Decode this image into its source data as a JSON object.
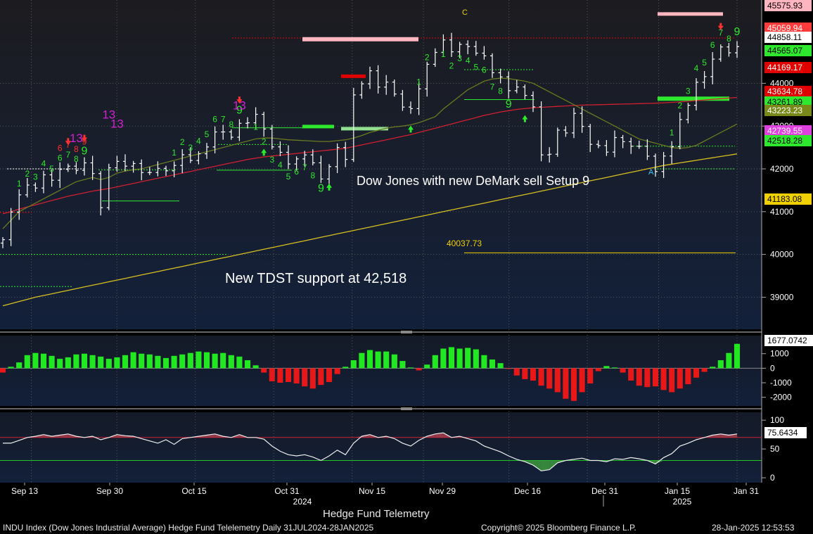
{
  "chart_data": {
    "type": "candlestick",
    "chart_title": "Hedge Fund Telemetry",
    "instrument_label": "INDU Index (Dow Jones Industrial Average) Hedge Fund Telelemetry  Daily 31JUL2024-28JAN2025",
    "copyright": "Copyright© 2025 Bloomberg Finance L.P.",
    "timestamp": "28-Jan-2025 12:53:53",
    "annotations": {
      "setup_note": "Dow Jones with new DeMark sell Setup 9",
      "tdst_note": "New TDST support at 42,518",
      "level_label": "40037.73",
      "c_marker": "C",
      "a_marker": "A"
    },
    "x_axis": {
      "tick_labels": [
        "Sep 13",
        "Sep 30",
        "Oct 15",
        "Oct 31",
        "Nov 15",
        "Nov 29",
        "Dec 16",
        "Dec 31",
        "Jan 15",
        "Jan 31"
      ],
      "year_labels": [
        "2024",
        "2025"
      ]
    },
    "price_panel": {
      "ylim": [
        38300,
        45750
      ],
      "y_ticks": [
        39000,
        40000,
        41000,
        42000,
        43000,
        44000
      ],
      "tag_values": [
        "45575.93",
        "45059.94",
        "44858.11",
        "44565.07",
        "44169.17",
        "43634.78",
        "43261.89",
        "43223.23",
        "42739.55",
        "42518.28",
        "41183.08"
      ],
      "tag_colors": [
        "#ffb6c1",
        "#ff3b3b",
        "#ffffff",
        "#2ee82e",
        "#e00000",
        "#e00000",
        "#2ee82e",
        "#7a8a1a",
        "#e040e0",
        "#2ee82e",
        "#f0d000"
      ],
      "closes": [
        40345,
        40990,
        41393,
        41622,
        41551,
        41861,
        41734,
        41988,
        42063,
        41965,
        42140,
        41890,
        41092,
        42025,
        42175,
        42063,
        42125,
        41914,
        41915,
        42012,
        41954,
        42080,
        42330,
        42196,
        42353,
        42512,
        42863,
        42864,
        42740,
        43065,
        43077,
        43275,
        42932,
        42514,
        42387,
        42114,
        42233,
        42326,
        42141,
        41763,
        42052,
        42500,
        42221,
        43729,
        43988,
        44293,
        43911,
        44029,
        43750,
        43445,
        43408,
        43870,
        44444,
        44722,
        45014,
        44736,
        44910,
        44860,
        44705,
        44642,
        44247,
        44149,
        43827,
        43914,
        43717,
        43449,
        42327,
        42342,
        42906,
        42840,
        43297,
        42992,
        42573,
        42544,
        42392,
        42732,
        42635,
        42529,
        42528,
        42297,
        41938,
        42300,
        42518,
        43153,
        43487,
        44025,
        44156,
        44565,
        44850,
        44713,
        44858
      ],
      "sma_olive": [
        40600,
        40800,
        41000,
        41100,
        41200,
        41300,
        41400,
        41500,
        41600,
        41700,
        41750,
        41800,
        41750,
        41800,
        41900,
        41950,
        41980,
        42000,
        42050,
        42100,
        42150,
        42200,
        42250,
        42300,
        42350,
        42400,
        42450,
        42500,
        42550,
        42600,
        42650,
        42700,
        42720,
        42720,
        42700,
        42680,
        42670,
        42660,
        42650,
        42640,
        42640,
        42660,
        42680,
        42720,
        42780,
        42850,
        42900,
        42950,
        42980,
        43000,
        43030,
        43080,
        43150,
        43220,
        43400,
        43550,
        43700,
        43850,
        43950,
        44050,
        44100,
        44120,
        44110,
        44080,
        44050,
        44000,
        43900,
        43800,
        43700,
        43600,
        43500,
        43400,
        43300,
        43200,
        43100,
        43000,
        42900,
        42800,
        42700,
        42650,
        42600,
        42550,
        42500,
        42480,
        42500,
        42550,
        42650,
        42750,
        42850,
        42950,
        43050
      ],
      "sma_red": [
        40950,
        41000,
        41060,
        41110,
        41160,
        41210,
        41260,
        41310,
        41360,
        41400,
        41440,
        41480,
        41510,
        41540,
        41580,
        41620,
        41660,
        41700,
        41740,
        41780,
        41820,
        41860,
        41900,
        41940,
        41980,
        42020,
        42060,
        42100,
        42140,
        42180,
        42220,
        42250,
        42280,
        42300,
        42320,
        42340,
        42360,
        42380,
        42400,
        42420,
        42440,
        42460,
        42480,
        42520,
        42560,
        42600,
        42640,
        42680,
        42720,
        42760,
        42800,
        42850,
        42900,
        42950,
        43000,
        43050,
        43100,
        43150,
        43200,
        43250,
        43290,
        43330,
        43360,
        43390,
        43410,
        43430,
        43440,
        43450,
        43460,
        43470,
        43480,
        43490,
        43495,
        43500,
        43505,
        43510,
        43515,
        43520,
        43525,
        43530,
        43535,
        43545,
        43555,
        43565,
        43580,
        43595,
        43610,
        43625,
        43640,
        43655,
        43670
      ],
      "sma_yellow": [
        38800,
        38850,
        38900,
        38950,
        39000,
        39040,
        39080,
        39120,
        39160,
        39200,
        39240,
        39280,
        39320,
        39360,
        39400,
        39440,
        39480,
        39520,
        39560,
        39600,
        39640,
        39680,
        39720,
        39760,
        39800,
        39840,
        39880,
        39920,
        39960,
        40000,
        40040,
        40080,
        40120,
        40160,
        40200,
        40240,
        40280,
        40320,
        40360,
        40400,
        40440,
        40480,
        40520,
        40560,
        40600,
        40640,
        40680,
        40720,
        40760,
        40800,
        40840,
        40880,
        40920,
        40960,
        41000,
        41040,
        41080,
        41120,
        41160,
        41200,
        41240,
        41280,
        41320,
        41360,
        41400,
        41440,
        41480,
        41520,
        41560,
        41600,
        41640,
        41680,
        41720,
        41760,
        41800,
        41840,
        41880,
        41920,
        41960,
        42000,
        42040,
        42080,
        42110,
        42140,
        42170,
        42200,
        42230,
        42260,
        42290,
        42320,
        42350
      ]
    },
    "macd_panel": {
      "ylim": [
        -2500,
        2100
      ],
      "y_ticks": [
        1000,
        0,
        -1000,
        -2000
      ],
      "tag_value": "1677.0742",
      "histogram": [
        -300,
        100,
        400,
        900,
        1050,
        1000,
        850,
        650,
        750,
        950,
        1000,
        900,
        800,
        650,
        750,
        900,
        1100,
        1000,
        950,
        850,
        700,
        850,
        950,
        1050,
        1150,
        1100,
        1000,
        1050,
        900,
        800,
        550,
        200,
        -300,
        -900,
        -1000,
        -950,
        -1050,
        -1250,
        -1400,
        -1150,
        -950,
        -400,
        100,
        550,
        1050,
        1250,
        1150,
        1150,
        950,
        500,
        50,
        -150,
        250,
        900,
        1350,
        1450,
        1350,
        1400,
        1300,
        900,
        600,
        350,
        -50,
        -500,
        -750,
        -850,
        -1200,
        -1400,
        -1650,
        -2100,
        -2250,
        -1650,
        -1050,
        -200,
        150,
        50,
        -300,
        -850,
        -1200,
        -1300,
        -1250,
        -1500,
        -1650,
        -1400,
        -1100,
        -650,
        -250,
        100,
        550,
        1050,
        1677
      ]
    },
    "osc_panel": {
      "ylim": [
        -6,
        110
      ],
      "y_ticks": [
        100,
        50,
        0
      ],
      "upper_line": 70,
      "lower_line": 30,
      "tag_value": "75.6434",
      "values": [
        60,
        60,
        65,
        70,
        72,
        75,
        72,
        74,
        76,
        72,
        70,
        72,
        66,
        70,
        75,
        73,
        72,
        68,
        64,
        60,
        66,
        58,
        68,
        70,
        72,
        74,
        76,
        72,
        70,
        75,
        70,
        70,
        67,
        55,
        46,
        40,
        38,
        40,
        36,
        30,
        38,
        48,
        40,
        60,
        72,
        75,
        70,
        72,
        68,
        60,
        55,
        65,
        72,
        76,
        78,
        70,
        72,
        68,
        64,
        55,
        50,
        45,
        38,
        32,
        28,
        22,
        12,
        14,
        26,
        30,
        32,
        34,
        30,
        30,
        28,
        33,
        32,
        35,
        33,
        30,
        24,
        35,
        42,
        55,
        60,
        66,
        70,
        74,
        76,
        74,
        76
      ]
    },
    "demark_labels": [
      "1",
      "2",
      "3",
      "4",
      "5",
      "6",
      "7",
      "8",
      "9",
      "13"
    ],
    "legend": []
  }
}
